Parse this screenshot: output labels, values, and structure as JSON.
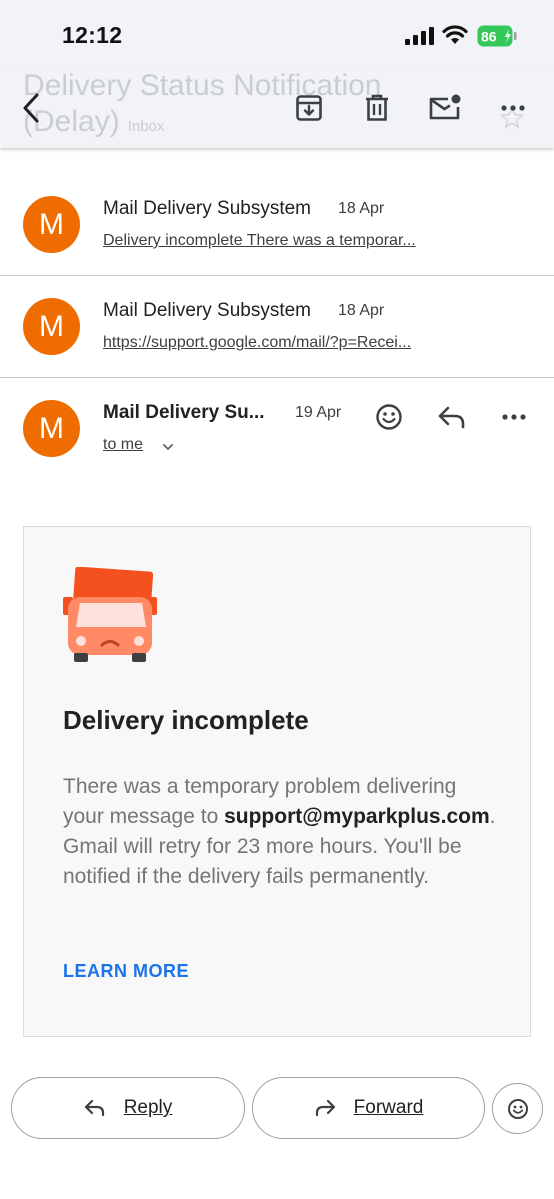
{
  "status_bar": {
    "time": "12:12",
    "battery": "86"
  },
  "header": {
    "subject": "Delivery Status Notification (Delay)",
    "label": "Inbox",
    "icons": [
      "back-icon",
      "archive-icon",
      "delete-icon",
      "mark-unread-icon",
      "more-icon",
      "star-icon"
    ]
  },
  "thread": [
    {
      "avatar": "M",
      "sender": "Mail Delivery Subsystem",
      "date": "18 Apr",
      "snippet": "Delivery incomplete There was a temporar..."
    },
    {
      "avatar": "M",
      "sender": "Mail Delivery Subsystem",
      "date": "18 Apr",
      "snippet": "https://support.google.com/mail/?p=Recei..."
    },
    {
      "avatar": "M",
      "sender": "Mail Delivery Su...",
      "date": "19 Apr",
      "recipient": "to me"
    }
  ],
  "message": {
    "title": "Delivery incomplete",
    "body_pre": "There was a temporary problem delivering your message to ",
    "email": "support@myparkplus.com",
    "body_post": ". Gmail will retry for 23 more hours. You'll be notified if the delivery fails permanently.",
    "link": "LEARN MORE"
  },
  "actions": {
    "reply": "Reply",
    "forward": "Forward"
  },
  "colors": {
    "avatar": "#ef6c00",
    "link": "#1a73e8",
    "battery": "#34c759",
    "truck_body": "#f4511e",
    "truck_cab": "#ff8a65"
  }
}
